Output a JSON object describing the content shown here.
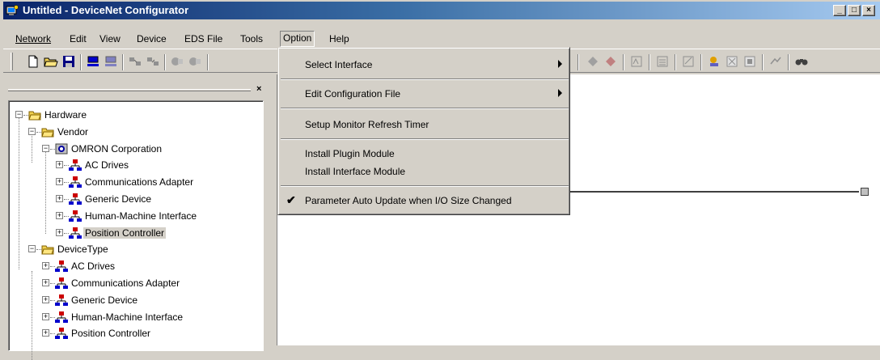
{
  "window": {
    "title": "Untitled - DeviceNet Configurator"
  },
  "menubar": {
    "network": "Network",
    "edit": "Edit",
    "view": "View",
    "device": "Device",
    "eds_file": "EDS File",
    "tools": "Tools",
    "option": "Option",
    "help": "Help"
  },
  "option_menu": {
    "select_interface": "Select Interface",
    "edit_config_file": "Edit Configuration File",
    "setup_monitor_timer": "Setup Monitor Refresh Timer",
    "install_plugin": "Install Plugin Module",
    "install_interface": "Install Interface Module",
    "param_auto_update": "Parameter Auto Update when I/O Size Changed",
    "param_auto_update_checked": true
  },
  "tree": {
    "hardware": "Hardware",
    "vendor": "Vendor",
    "omron": "OMRON Corporation",
    "vendor_items": [
      "AC Drives",
      "Communications Adapter",
      "Generic Device",
      "Human-Machine Interface",
      "Position Controller"
    ],
    "device_type": "DeviceType",
    "type_items": [
      "AC Drives",
      "Communications Adapter",
      "Generic Device",
      "Human-Machine Interface",
      "Position Controller"
    ],
    "selected": "Position Controller"
  },
  "colors": {
    "title_start": "#0a246a",
    "title_end": "#a6caf0",
    "face": "#d4d0c8",
    "device_red": "#cc0000",
    "device_blue": "#0000cc",
    "folder_yellow": "#f0d050"
  },
  "icons": [
    "app-icon",
    "new-file-icon",
    "open-folder-icon",
    "save-icon",
    "online-icon",
    "offline-icon",
    "upload-icon",
    "download-icon",
    "monitor-icon",
    "search-icon",
    "folder-icon",
    "device-icon",
    "check-icon",
    "close-icon"
  ]
}
